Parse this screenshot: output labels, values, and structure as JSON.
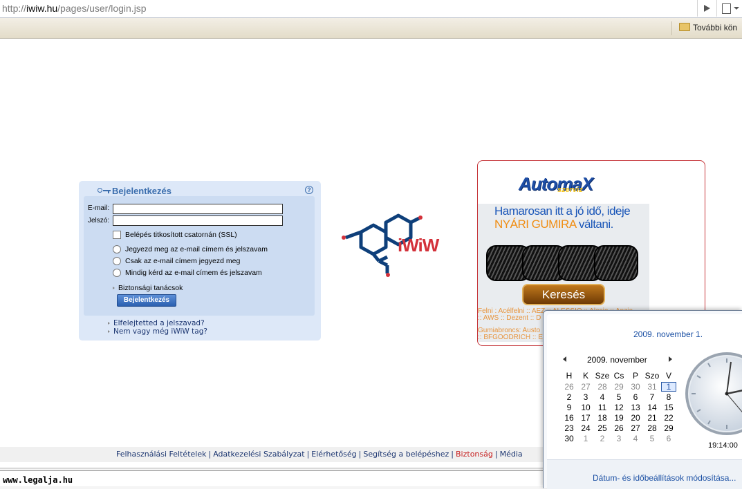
{
  "browser": {
    "url_prefix": "http://",
    "url_domain": "iwiw.hu",
    "url_path": "/pages/user/login.jsp",
    "bookmarks_other_label": "További kön"
  },
  "login": {
    "title": "Bejelentkezés",
    "email_label": "E-mail:",
    "email_value": "",
    "password_label": "Jelszó:",
    "password_value": "",
    "ssl_label": "Belépés titkosított csatornán (SSL)",
    "radio_options": [
      "Jegyezd meg az e-mail címem és jelszavam",
      "Csak az e-mail címem jegyezd meg",
      "Mindig kérd az e-mail címem és jelszavam"
    ],
    "security_tips": "Biztonsági tanácsok",
    "submit_label": "Bejelentkezés",
    "forgot_link": "Elfelejtetted a jelszavad?",
    "register_link": "Nem vagy még iWiW tag?"
  },
  "logo": {
    "text": "iWiW"
  },
  "ad": {
    "brand": "AutomaX",
    "brand_sub": "szerviz",
    "line1": "Hamarosan itt a jó idő, ideje",
    "line2_highlight": "NYÁRI GUMIRA",
    "line2_rest": " váltani.",
    "button_label": "Keresés",
    "small_lines": [
      "Felni : Acélfelni :: AEZ :: ALESSIO :: Alesio :: Anzio",
      ":: AWS :: Dezent :: D",
      "Gumiabroncs: Austo",
      ":: BFGOODRICH :: E"
    ]
  },
  "footer": {
    "links": [
      "Felhasználási Feltételek",
      "Adatkezelési Szabályzat",
      "Elérhetőség",
      "Segítség a belépéshez",
      "Biztonság",
      "Média"
    ],
    "separator": "|"
  },
  "watermark": "www.legalja.hu",
  "calendar": {
    "date_long": "2009. november 1.",
    "month_label": "2009. november",
    "weekdays": [
      "H",
      "K",
      "Sze",
      "Cs",
      "P",
      "Szo",
      "V"
    ],
    "weeks": [
      [
        "26",
        "27",
        "28",
        "29",
        "30",
        "31",
        "1"
      ],
      [
        "2",
        "3",
        "4",
        "5",
        "6",
        "7",
        "8"
      ],
      [
        "9",
        "10",
        "11",
        "12",
        "13",
        "14",
        "15"
      ],
      [
        "16",
        "17",
        "18",
        "19",
        "20",
        "21",
        "22"
      ],
      [
        "23",
        "24",
        "25",
        "26",
        "27",
        "28",
        "29"
      ],
      [
        "30",
        "1",
        "2",
        "3",
        "4",
        "5",
        "6"
      ]
    ],
    "today": "1",
    "time": "19:14:00",
    "settings_link": "Dátum- és időbeállítások módosítása..."
  }
}
